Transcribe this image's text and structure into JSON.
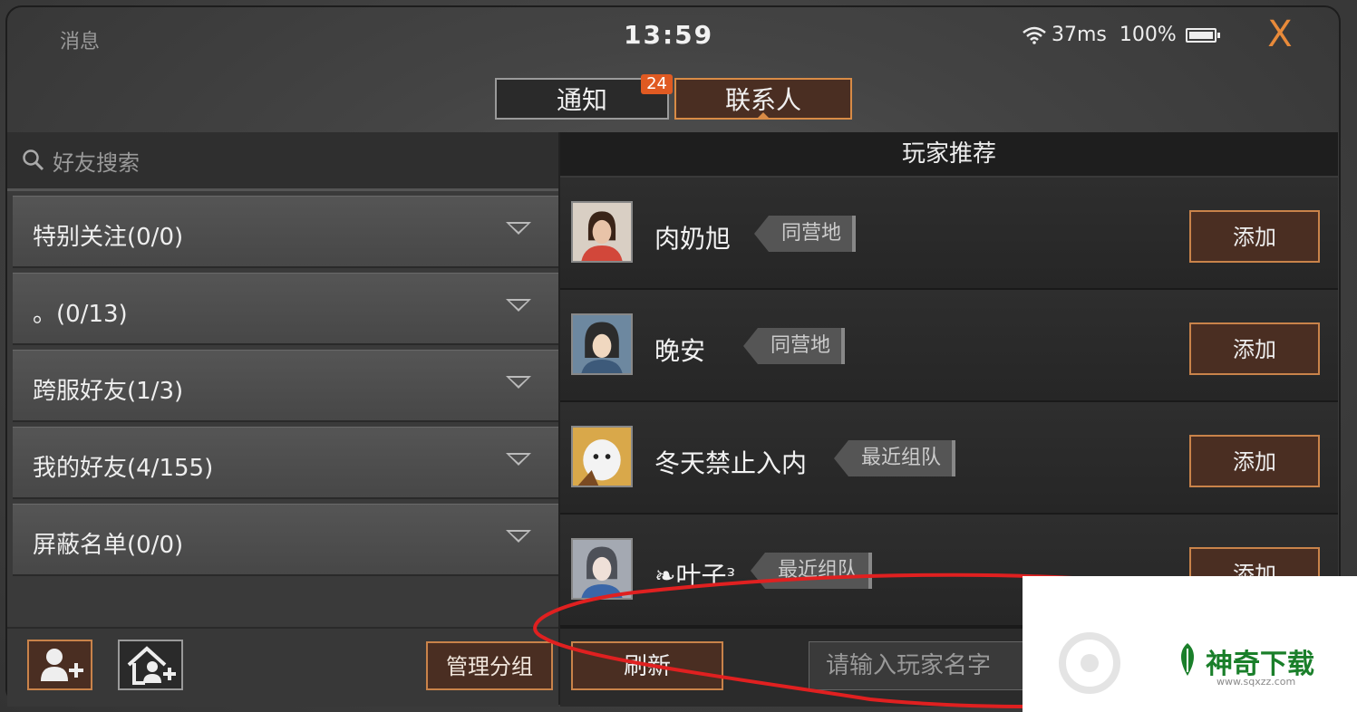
{
  "status_bar": {
    "left_label": "消息",
    "time": "13:59",
    "ping": "37ms",
    "battery_percent": "100%"
  },
  "close_label": "X",
  "tabs": [
    {
      "label": "通知",
      "badge": "24",
      "active": false
    },
    {
      "label": "联系人",
      "active": true
    }
  ],
  "left_panel": {
    "search_placeholder": "好友搜索",
    "groups": [
      {
        "label": "特别关注(0/0)"
      },
      {
        "label": "。(0/13)"
      },
      {
        "label": "跨服好友(1/3)"
      },
      {
        "label": "我的好友(4/155)"
      },
      {
        "label": "屏蔽名单(0/0)"
      }
    ],
    "manage_group_label": "管理分组"
  },
  "right_panel": {
    "title": "玩家推荐",
    "players": [
      {
        "name": "肉奶旭",
        "tag": "同营地",
        "add_label": "添加"
      },
      {
        "name": "晚安",
        "tag": "同营地",
        "add_label": "添加"
      },
      {
        "name": "冬天禁止入内",
        "tag": "最近组队",
        "add_label": "添加"
      },
      {
        "name": "❧叶子ᵌ",
        "tag": "最近组队",
        "add_label": "添加"
      }
    ],
    "refresh_label": "刷新",
    "player_input_placeholder": "请输入玩家名字"
  },
  "watermark": {
    "text": "神奇下载",
    "url": "www.sqxzz.com"
  },
  "colors": {
    "accent_orange": "#c9834a",
    "button_bg": "#4a2e22",
    "badge": "#e05a22",
    "annotation_red": "#e02020",
    "watermark_green": "#1a7f2a"
  }
}
